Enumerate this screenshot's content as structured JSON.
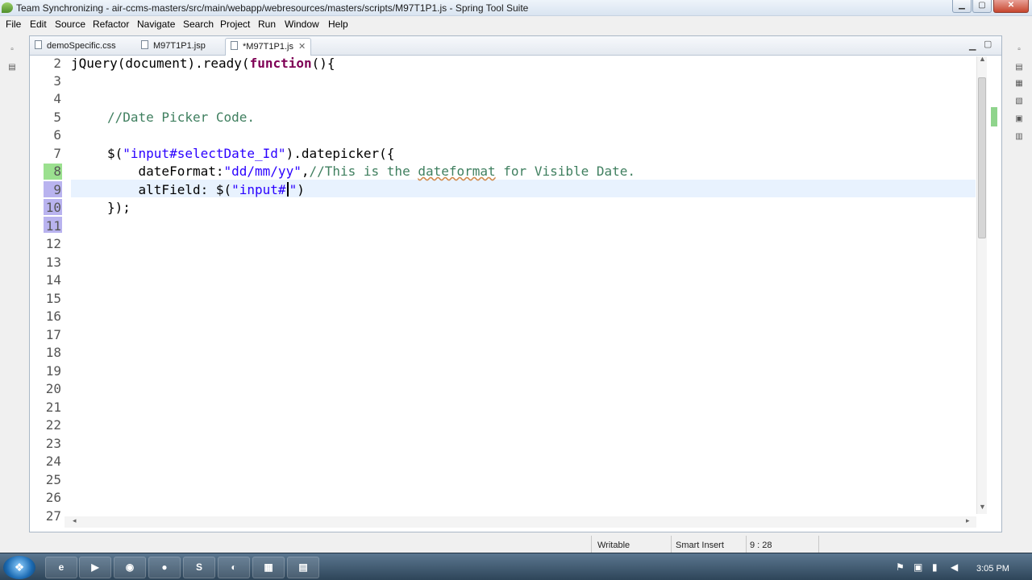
{
  "window": {
    "title": "Team Synchronizing - air-ccms-masters/src/main/webapp/webresources/masters/scripts/M97T1P1.js - Spring Tool Suite"
  },
  "menu": [
    "File",
    "Edit",
    "Source",
    "Refactor",
    "Navigate",
    "Search",
    "Project",
    "Run",
    "Window",
    "Help"
  ],
  "tabs": [
    "demoSpecific.css",
    "M97T1P1.jsp",
    "*M97T1P1.js"
  ],
  "tab_close_glyph": "✕",
  "line_numbers": [
    "2",
    "3",
    "4",
    "5",
    "6",
    "7",
    "8",
    "9",
    "10",
    "11",
    "12",
    "13",
    "14",
    "15",
    "16",
    "17",
    "18",
    "19",
    "20",
    "21",
    "22",
    "23",
    "24",
    "25",
    "26",
    "27"
  ],
  "code": {
    "l2a": "jQuery(document).ready(",
    "l2b": "function",
    "l2c": "(){",
    "l5": "//Date Picker Code.",
    "l7a": "$(",
    "l7b": "\"input#selectDate_Id\"",
    "l7c": ").datepicker({",
    "l8a": "    dateFormat:",
    "l8b": "\"dd/mm/yy\"",
    "l8c": ",",
    "l8d": "//This is the ",
    "l8e": "dateformat",
    "l8f": " for Visible Date.",
    "l9a": "    altField: $(",
    "l9b": "\"input#",
    "l9c": "\"",
    "l9d": ")",
    "l10": "});"
  },
  "status": {
    "writable": "Writable",
    "insert_mode": "Smart Insert",
    "position": "9 : 28"
  },
  "tray": {
    "clock": "3:05 PM"
  },
  "colors": {
    "keyword": "#7f0055",
    "string": "#2a00ff",
    "comment": "#3f7f5f",
    "current_line": "#e8f2fe"
  },
  "icons": {
    "start": "windows-orb-icon"
  }
}
